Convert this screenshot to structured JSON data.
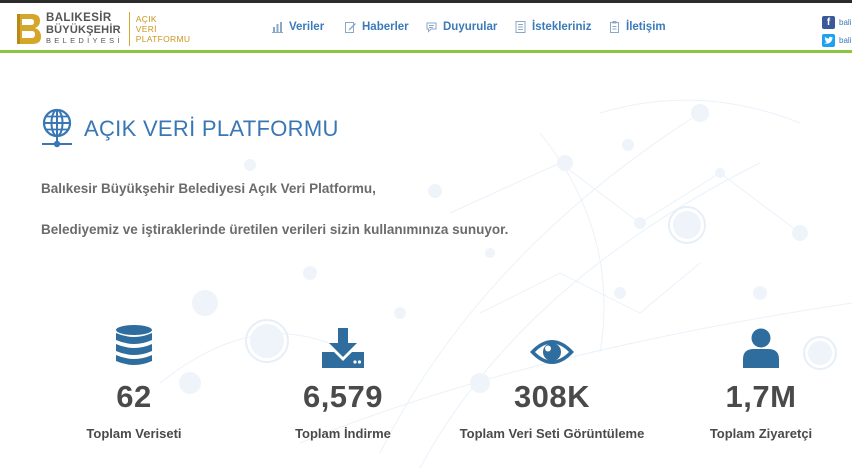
{
  "logo": {
    "line1": "BALIKESİR",
    "line2": "BÜYÜKŞEHİR",
    "line3": "BELEDİYESİ",
    "sub1": "AÇIK",
    "sub2": "VERİ",
    "sub3": "PLATFORMU"
  },
  "nav": {
    "items": [
      {
        "label": "Veriler",
        "icon": "chart-icon"
      },
      {
        "label": "Haberler",
        "icon": "edit-icon"
      },
      {
        "label": "Duyurular",
        "icon": "chat-icon"
      },
      {
        "label": "İstekleriniz",
        "icon": "list-icon"
      },
      {
        "label": "İletişim",
        "icon": "clipboard-icon"
      }
    ]
  },
  "social": {
    "facebook_text": "bali",
    "twitter_text": "bali"
  },
  "page": {
    "title": "AÇIK VERİ PLATFORMU",
    "intro1": "Balıkesir Büyükşehir Belediyesi Açık Veri Platformu,",
    "intro2": "Belediyemiz ve iştiraklerinde üretilen verileri sizin kullanımınıza sunuyor."
  },
  "stats": [
    {
      "value": "62",
      "label": "Toplam Veriseti",
      "icon": "database-icon"
    },
    {
      "value": "6,579",
      "label": "Toplam İndirme",
      "icon": "download-icon"
    },
    {
      "value": "308K",
      "label": "Toplam Veri Seti Görüntüleme",
      "icon": "eye-icon"
    },
    {
      "value": "1,7M",
      "label": "Toplam Ziyaretçi",
      "icon": "user-icon"
    }
  ],
  "colors": {
    "accent": "#3877b4",
    "green_line": "#8cc540",
    "gold": "#c9961b",
    "text": "#4a4a4a"
  }
}
